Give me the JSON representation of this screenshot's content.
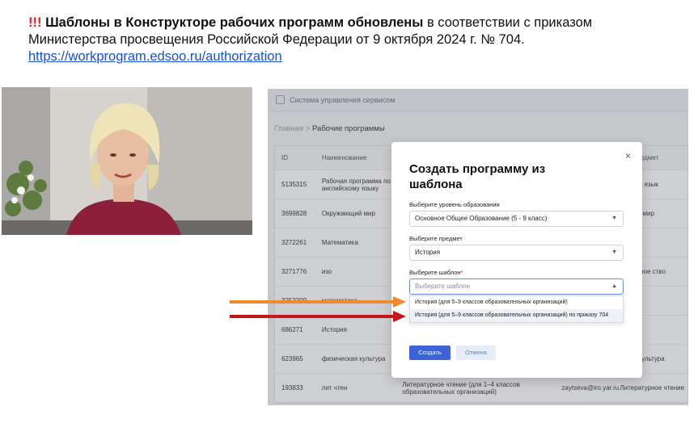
{
  "headline": {
    "bang": "!!!",
    "bold": "Шаблоны в Конструкторе рабочих программ обновлены",
    "rest": " в соответствии с приказом Министерства просвещения Российской Федерации от 9 октября 2024 г. № 704.",
    "link": "https://workprogram.edsoo.ru/authorization"
  },
  "app": {
    "system_title": "Система управления сервисом",
    "breadcrumb_home": "Главная",
    "breadcrumb_sep": ">",
    "breadcrumb_current": "Рабочие программы",
    "table": {
      "headers": [
        "ID",
        "Наименование",
        "",
        "",
        "ный предмет"
      ],
      "rows": [
        [
          "5135315",
          "Рабочая программа по английскому языку",
          "",
          "",
          "ранный язык"
        ],
        [
          "3699828",
          "Окружающий мир",
          "",
          "",
          "ающий мир"
        ],
        [
          "3272261",
          "Математика",
          "",
          "",
          "атика"
        ],
        [
          "3271776",
          "изо",
          "",
          "",
          "зительное ство"
        ],
        [
          "3252209",
          "математика",
          "",
          "",
          "а"
        ],
        [
          "686271",
          "История",
          "",
          "",
          ""
        ],
        [
          "623965",
          "физическая культура",
          "",
          "",
          "еская культура"
        ],
        [
          "193833",
          "лит чтен",
          "Литературное чтение (для 1–4 классов образовательных организаций)",
          "zaytseva@iro.yar.ru",
          "Литературное чтение"
        ]
      ]
    }
  },
  "modal": {
    "close": "×",
    "title": "Создать программу из шаблона",
    "level_label": "Выберите уровень образования",
    "level_value": "Основное Общее Образование (5 - 9 класс)",
    "subject_label": "Выберите предмет",
    "subject_value": "История",
    "template_label": "Выберите шаблон",
    "template_required": "*",
    "template_placeholder": "Выберите шаблон",
    "options": [
      "История (для 5–9 классов образовательных организаций)",
      "История (для 5–9 классов образовательных организаций) по приказу 704"
    ],
    "create": "Создать",
    "cancel": "Отмена"
  },
  "colors": {
    "arrow_orange": "#f08a2c",
    "arrow_red": "#c41818",
    "primary": "#3c63d8"
  }
}
